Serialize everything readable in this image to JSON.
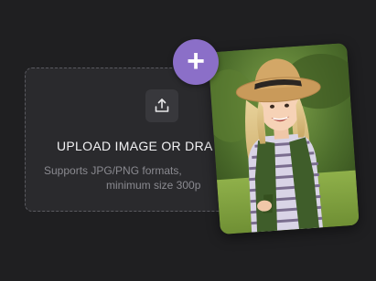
{
  "upload": {
    "title": "UPLOAD IMAGE OR DRA",
    "hint_line1": "Supports JPG/PNG formats,",
    "hint_line2": "minimum size 300p",
    "icon": "upload-icon"
  },
  "add_button": {
    "glyph": "+",
    "icon": "plus-icon",
    "color": "#8b6fc8"
  },
  "photo": {
    "icon": "sample-photo"
  },
  "colors": {
    "background": "#1f1f21",
    "dropzone": "#2a2a2d",
    "accent": "#8b6fc8"
  }
}
